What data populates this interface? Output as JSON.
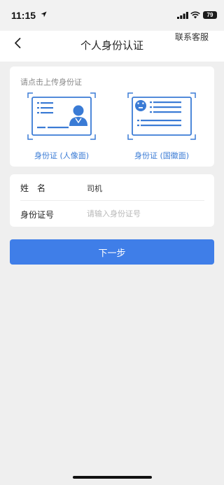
{
  "status_bar": {
    "time": "11:15",
    "battery": "79",
    "icons": [
      "location-arrow-icon",
      "signal-icon",
      "wifi-icon",
      "battery-icon"
    ]
  },
  "nav": {
    "title": "个人身份认证",
    "contact": "联系客服",
    "back_icon": "chevron-left-icon"
  },
  "upload": {
    "hint": "请点击上传身份证",
    "front_label": "身份证 (人像面)",
    "back_label": "身份证 (国徽面)"
  },
  "form": {
    "name_label": "姓　名",
    "name_value": "司机",
    "id_label": "身份证号",
    "id_placeholder": "请输入身份证号",
    "id_value": ""
  },
  "next_button": "下一步",
  "colors": {
    "accent": "#3f7ee8",
    "card_blue": "#3a7bd5",
    "background": "#efefef"
  }
}
